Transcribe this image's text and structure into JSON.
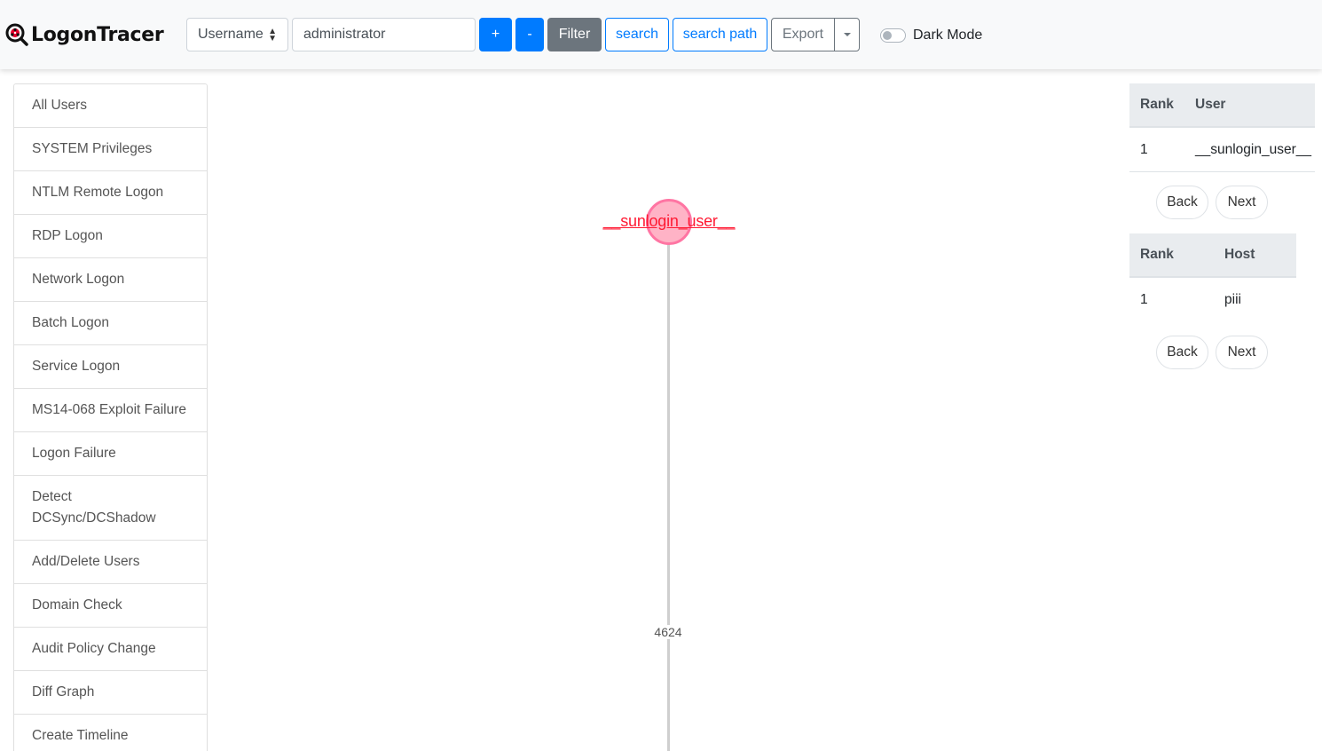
{
  "header": {
    "brand": "LogonTracer",
    "search_type": "Username",
    "search_value": "administrator",
    "plus_label": "+",
    "minus_label": "-",
    "filter_label": "Filter",
    "search_label": "search",
    "search_path_label": "search path",
    "export_label": "Export",
    "dark_mode_label": "Dark Mode",
    "dark_mode_on": false
  },
  "sidebar": {
    "items": [
      "All Users",
      "SYSTEM Privileges",
      "NTLM Remote Logon",
      "RDP Logon",
      "Network Logon",
      "Batch Logon",
      "Service Logon",
      "MS14-068 Exploit Failure",
      "Logon Failure",
      "Detect DCSync/DCShadow",
      "Add/Delete Users",
      "Domain Check",
      "Audit Policy Change",
      "Diff Graph",
      "Create Timeline"
    ]
  },
  "graph": {
    "node_label": "__sunlogin_user__",
    "edge_label": "4624",
    "colors": {
      "node_fill": "#ffb3c6",
      "node_border": "#ff75a3",
      "node_text": "#ff1a33",
      "edge": "#cfcfcf"
    }
  },
  "user_rank": {
    "col_rank": "Rank",
    "col_user": "User",
    "rows": [
      {
        "rank": "1",
        "user": "__sunlogin_user__"
      }
    ],
    "back_label": "Back",
    "next_label": "Next"
  },
  "host_rank": {
    "col_rank": "Rank",
    "col_host": "Host",
    "rows": [
      {
        "rank": "1",
        "host": "piii"
      }
    ],
    "back_label": "Back",
    "next_label": "Next"
  }
}
